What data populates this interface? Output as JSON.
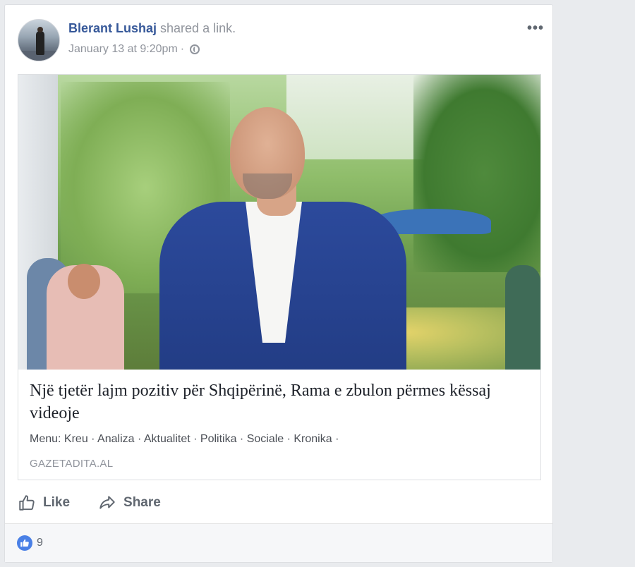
{
  "post": {
    "author": "Blerant Lushaj",
    "action_text": " shared a link.",
    "timestamp": "January 13 at 9:20pm",
    "separator": " · ",
    "privacy_icon": "globe-icon",
    "more_label": "•••"
  },
  "link_preview": {
    "headline": "Një tjetër lajm pozitiv për Shqipërinë, Rama e zbulon përmes këssaj videoje",
    "description": "Menu: Kreu · Analiza · Aktualitet · Politika · Sociale · Kronika ·",
    "domain": "GAZETADITA.AL"
  },
  "actions": {
    "like_label": "Like",
    "share_label": "Share"
  },
  "reactions": {
    "count": "9",
    "icon": "thumbs-up-icon"
  },
  "colors": {
    "author_link": "#365899",
    "like_bubble": "#4a80e6",
    "background": "#e9ebee"
  }
}
